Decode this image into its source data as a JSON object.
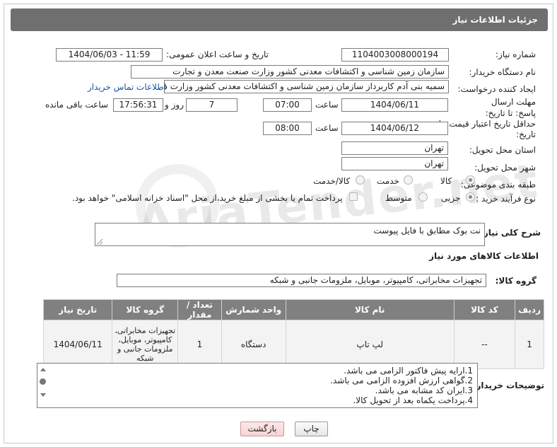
{
  "header": {
    "title": "جزئیات اطلاعات نیاز"
  },
  "fields": {
    "need_number_label": "شماره نیاز:",
    "need_number": "1104003008000194",
    "announce_label": "تاریخ و ساعت اعلان عمومی:",
    "announce_value": "1404/06/03 - 11:59",
    "buyer_org_label": "نام دستگاه خریدار:",
    "buyer_org": "سازمان زمین شناسی و اکتشافات معدنی کشور وزارت صنعت معدن و تجارت",
    "requester_label": "ایجاد کننده درخواست:",
    "requester": "سمیه بنی آدم کاربرداز سازمان زمین شناسی و اکتشافات معدنی کشور وزارت د",
    "contact_link": "اطلاعات تماس خریدار",
    "deadline_label": "مهلت ارسال پاسخ: تا تاریخ:",
    "deadline_date": "1404/06/11",
    "time_label": "ساعت",
    "deadline_time": "07:00",
    "days_value": "7",
    "days_label": "روز و",
    "remaining_time": "17:56:31",
    "remaining_label": "ساعت باقی مانده",
    "validity_label": "حداقل تاریخ اعتبار قیمت: تا تاریخ:",
    "validity_date": "1404/06/12",
    "validity_time": "08:00",
    "province_label": "استان محل تحویل:",
    "province": "تهران",
    "city_label": "شهر محل تحویل:",
    "city": "تهران",
    "category_label": "طبقه بندی موضوعی:",
    "category_options": [
      "کالا",
      "خدمت",
      "کالا/خدمت"
    ],
    "category_selected": "کالا",
    "process_label": "نوع فرآیند خرید :",
    "process_options": [
      "جزیی",
      "متوسط"
    ],
    "process_selected": "جزیی",
    "payment_note": "پرداخت تمام یا بخشی از مبلغ خرید،از محل \"اسناد خزانه اسلامی\" خواهد بود."
  },
  "description": {
    "label": "شرح کلی نیاز:",
    "value": "نت بوک مطابق با فایل پیوست"
  },
  "goods": {
    "section_title": "اطلاعات کالاهای مورد نیاز",
    "group_label": "گروه کالا:",
    "group_value": "تجهیزات مخابراتی، کامپیوتر، موبایل، ملزومات جانبی و شبکه",
    "columns": [
      "ردیف",
      "کد کالا",
      "نام کالا",
      "واحد شمارش",
      "تعداد / مقدار",
      "گروه کالا",
      "تاریخ نیاز"
    ],
    "rows": [
      {
        "row": "1",
        "code": "--",
        "name": "لپ تاپ",
        "unit": "دستگاه",
        "qty": "1",
        "group": "تجهیزات مخابراتی، کامپیوتر، موبایل، ملزومات جانبی و شبکه",
        "date": "1404/06/11"
      }
    ]
  },
  "buyer_notes": {
    "label": "توضیحات خریدار:",
    "lines": [
      "1.ارایه پیش فاکتور الزامی می باشد.",
      "2.گواهی ارزش افزوده الزامی می باشد.",
      "3.ایران کد مشابه می باشد.",
      "4.پرداخت یکماه بعد از تحویل کالا."
    ]
  },
  "buttons": {
    "print": "چاپ",
    "back": "بازگشت"
  },
  "watermark": "AriaTender.net",
  "colors": {
    "header_bg": "#6f6f6f",
    "table_header_bg": "#808080",
    "link": "#1a55a8"
  }
}
